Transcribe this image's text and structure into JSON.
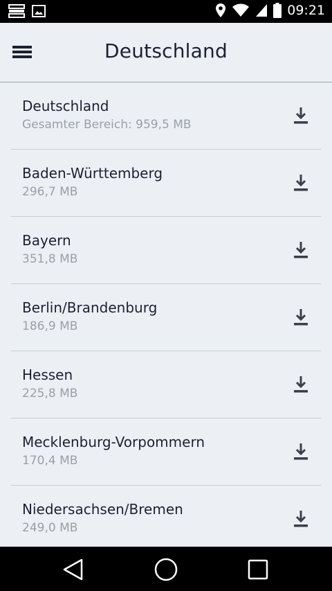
{
  "status_bar": {
    "time": "09:21",
    "icons": [
      "notification-list-icon",
      "image-icon",
      "location-icon",
      "wifi-icon",
      "signal-icon",
      "battery-icon"
    ]
  },
  "app_bar": {
    "title": "Deutschland",
    "menu_icon": "hamburger-menu-icon"
  },
  "regions": [
    {
      "name": "Deutschland",
      "size": "Gesamter Bereich: 959,5 MB"
    },
    {
      "name": "Baden-Württemberg",
      "size": "296,7 MB"
    },
    {
      "name": "Bayern",
      "size": "351,8 MB"
    },
    {
      "name": "Berlin/Brandenburg",
      "size": "186,9 MB"
    },
    {
      "name": "Hessen",
      "size": "225,8 MB"
    },
    {
      "name": "Mecklenburg-Vorpommern",
      "size": "170,4 MB"
    },
    {
      "name": "Niedersachsen/Bremen",
      "size": "249,0 MB"
    }
  ],
  "nav_bar": {
    "icons": [
      "back-icon",
      "home-icon",
      "recents-icon"
    ]
  },
  "colors": {
    "background": "#ecf0f4",
    "title_text": "#1c2033",
    "secondary_text": "#9aa0a8",
    "icon": "#3a3f4a",
    "divider": "#c7cdd3"
  }
}
